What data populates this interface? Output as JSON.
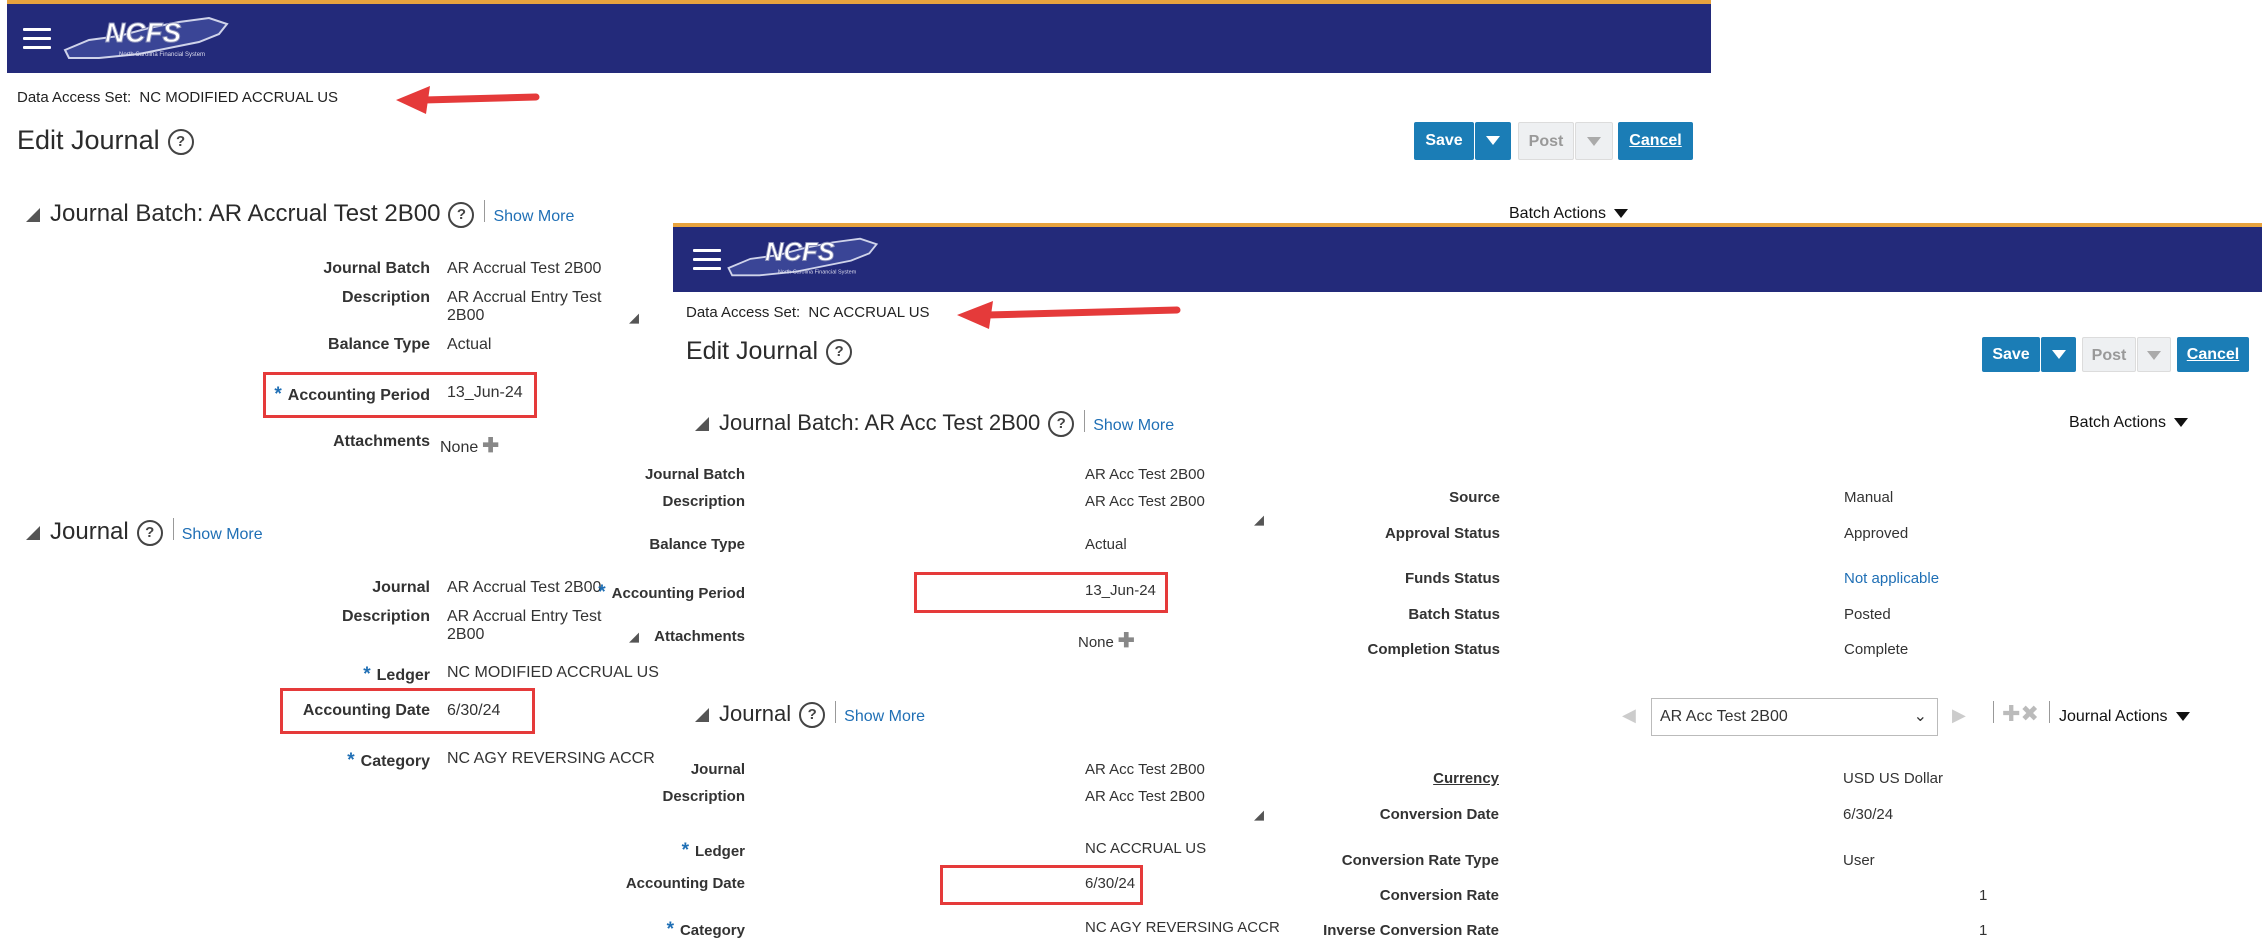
{
  "left": {
    "banner": {
      "logo_text": "NCFS",
      "logo_subtext": "North Carolina Financial System"
    },
    "data_access_label": "Data Access Set:",
    "data_access_value": "NC MODIFIED ACCRUAL US",
    "page_title": "Edit Journal",
    "toolbar": {
      "save": "Save",
      "post": "Post",
      "cancel": "Cancel"
    },
    "batch_actions": "Batch Actions",
    "batch_section": {
      "title": "Journal Batch: AR Accrual Test 2B00",
      "show_more": "Show More",
      "fields": {
        "journal_batch_label": "Journal Batch",
        "journal_batch_value": "AR Accrual Test 2B00",
        "description_label": "Description",
        "description_value": "AR Accrual Entry Test 2B00",
        "balance_type_label": "Balance Type",
        "balance_type_value": "Actual",
        "accounting_period_label": "Accounting Period",
        "accounting_period_value": "13_Jun-24",
        "attachments_label": "Attachments",
        "attachments_value": "None"
      }
    },
    "journal_section": {
      "title": "Journal",
      "show_more": "Show More",
      "fields": {
        "journal_label": "Journal",
        "journal_value": "AR Accrual Test 2B00",
        "description_label": "Description",
        "description_value": "AR Accrual Entry Test 2B00",
        "ledger_label": "Ledger",
        "ledger_value": "NC MODIFIED ACCRUAL US",
        "accounting_date_label": "Accounting Date",
        "accounting_date_value": "6/30/24",
        "category_label": "Category",
        "category_value": "NC AGY REVERSING ACCR"
      }
    }
  },
  "right": {
    "banner": {
      "logo_text": "NCFS",
      "logo_subtext": "North Carolina Financial System"
    },
    "data_access_label": "Data Access Set:",
    "data_access_value": "NC ACCRUAL US",
    "page_title": "Edit Journal",
    "toolbar": {
      "save": "Save",
      "post": "Post",
      "cancel": "Cancel"
    },
    "batch_actions": "Batch Actions",
    "batch_section": {
      "title": "Journal Batch: AR Acc Test 2B00",
      "show_more": "Show More",
      "fields": {
        "journal_batch_label": "Journal Batch",
        "journal_batch_value": "AR Acc Test 2B00",
        "description_label": "Description",
        "description_value": "AR Acc Test 2B00",
        "balance_type_label": "Balance Type",
        "balance_type_value": "Actual",
        "accounting_period_label": "Accounting Period",
        "accounting_period_value": "13_Jun-24",
        "attachments_label": "Attachments",
        "attachments_value": "None",
        "source_label": "Source",
        "source_value": "Manual",
        "approval_status_label": "Approval Status",
        "approval_status_value": "Approved",
        "funds_status_label": "Funds Status",
        "funds_status_value": "Not applicable",
        "batch_status_label": "Batch Status",
        "batch_status_value": "Posted",
        "completion_status_label": "Completion Status",
        "completion_status_value": "Complete"
      }
    },
    "journal_section": {
      "title": "Journal",
      "show_more": "Show More",
      "journal_select_value": "AR Acc Test 2B00",
      "journal_actions": "Journal Actions",
      "fields": {
        "journal_label": "Journal",
        "journal_value": "AR Acc Test 2B00",
        "description_label": "Description",
        "description_value": "AR Acc Test 2B00",
        "ledger_label": "Ledger",
        "ledger_value": "NC ACCRUAL US",
        "accounting_date_label": "Accounting Date",
        "accounting_date_value": "6/30/24",
        "category_label": "Category",
        "category_value": "NC AGY REVERSING ACCR",
        "currency_label": "Currency",
        "currency_value": "USD US Dollar",
        "conversion_date_label": "Conversion Date",
        "conversion_date_value": "6/30/24",
        "conversion_rate_type_label": "Conversion Rate Type",
        "conversion_rate_type_value": "User",
        "conversion_rate_label": "Conversion Rate",
        "conversion_rate_value": "1",
        "inverse_conversion_rate_label": "Inverse Conversion Rate",
        "inverse_conversion_rate_value": "1"
      }
    }
  },
  "colors": {
    "banner": "#232a7a",
    "accent_stripe": "#e7a33e",
    "button_blue": "#1b7db6",
    "link": "#1f6fb5",
    "highlight_red": "#e53a3a"
  },
  "icons": [
    "hamburger-menu-icon",
    "help-icon",
    "expand-triangle-icon",
    "add-plus-icon",
    "dropdown-caret-icon",
    "red-arrow-annotation"
  ]
}
